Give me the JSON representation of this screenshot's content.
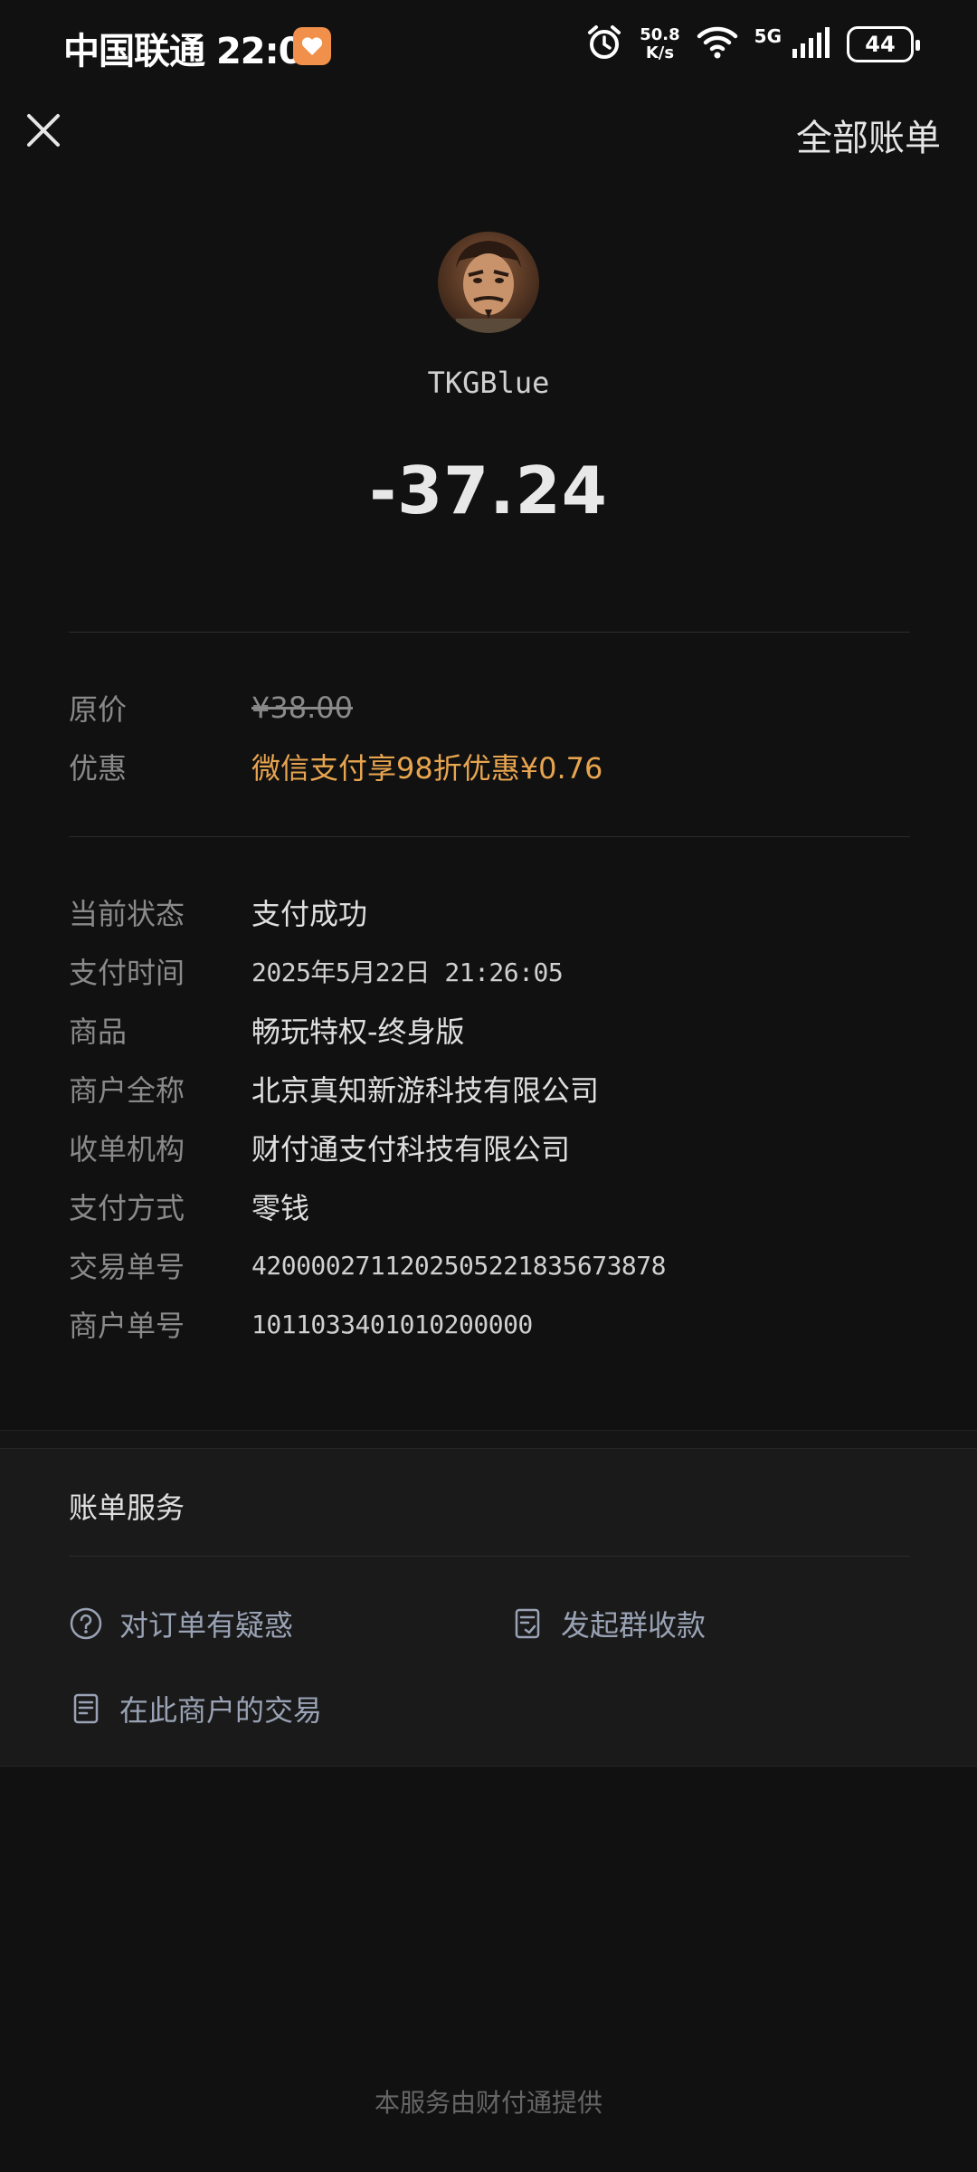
{
  "status_bar": {
    "carrier": "中国联通",
    "time": "22:05",
    "speed_value": "50.8",
    "speed_unit": "K/s",
    "network": "5G",
    "battery": "44"
  },
  "header": {
    "all_bills_label": "全部账单"
  },
  "payee": {
    "name": "TKGBlue",
    "amount": "-37.24"
  },
  "pricing": [
    {
      "label": "原价",
      "value": "¥38.00",
      "style": "strike"
    },
    {
      "label": "优惠",
      "value": "微信支付享98折优惠¥0.76",
      "style": "orange"
    }
  ],
  "details": [
    {
      "label": "当前状态",
      "value": "支付成功"
    },
    {
      "label": "支付时间",
      "value": "2025年5月22日 21:26:05"
    },
    {
      "label": "商品",
      "value": "畅玩特权-终身版"
    },
    {
      "label": "商户全称",
      "value": "北京真知新游科技有限公司"
    },
    {
      "label": "收单机构",
      "value": "财付通支付科技有限公司"
    },
    {
      "label": "支付方式",
      "value": "零钱"
    },
    {
      "label": "交易单号",
      "value": "4200002711202505221835673878"
    },
    {
      "label": "商户单号",
      "value": "1011033401010200000"
    }
  ],
  "services": {
    "title": "账单服务",
    "items": [
      {
        "label": "对订单有疑惑",
        "icon": "question-circle-icon"
      },
      {
        "label": "发起群收款",
        "icon": "document-check-icon"
      },
      {
        "label": "在此商户的交易",
        "icon": "document-list-icon"
      }
    ]
  },
  "footer": "本服务由财付通提供",
  "colors": {
    "background": "#111111",
    "discount": "#e8a550",
    "service_link": "#9aa3b5",
    "app_badge": "#f0904a"
  }
}
